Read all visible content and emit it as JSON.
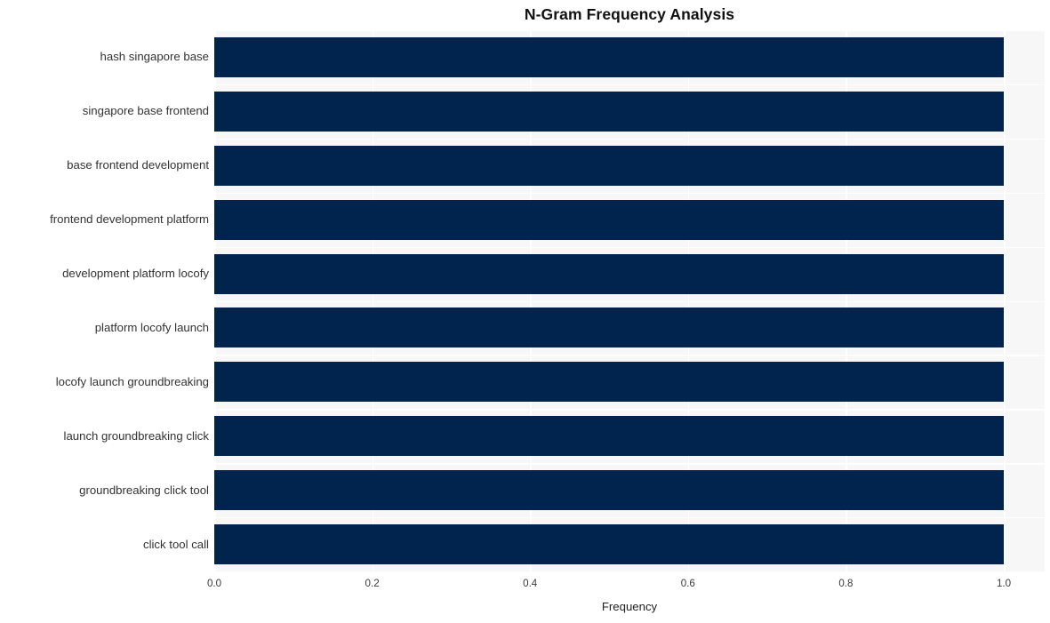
{
  "chart_data": {
    "type": "bar",
    "orientation": "horizontal",
    "title": "N-Gram Frequency Analysis",
    "xlabel": "Frequency",
    "ylabel": "",
    "categories": [
      "hash singapore base",
      "singapore base frontend",
      "base frontend development",
      "frontend development platform",
      "development platform locofy",
      "platform locofy launch",
      "locofy launch groundbreaking",
      "launch groundbreaking click",
      "groundbreaking click tool",
      "click tool call"
    ],
    "values": [
      1.0,
      1.0,
      1.0,
      1.0,
      1.0,
      1.0,
      1.0,
      1.0,
      1.0,
      1.0
    ],
    "xlim": [
      0.0,
      1.0
    ],
    "xticks": [
      "0.0",
      "0.2",
      "0.4",
      "0.6",
      "0.8",
      "1.0"
    ],
    "xtick_values": [
      0.0,
      0.2,
      0.4,
      0.6,
      0.8,
      1.0
    ],
    "grid": true,
    "grid_axis": "both",
    "legend": "none",
    "bar_color": "#00244d",
    "plot_background": "#f7f7f7",
    "grid_color": "#ffffff",
    "figure_background": "#ffffff",
    "text_color": "#333333"
  }
}
